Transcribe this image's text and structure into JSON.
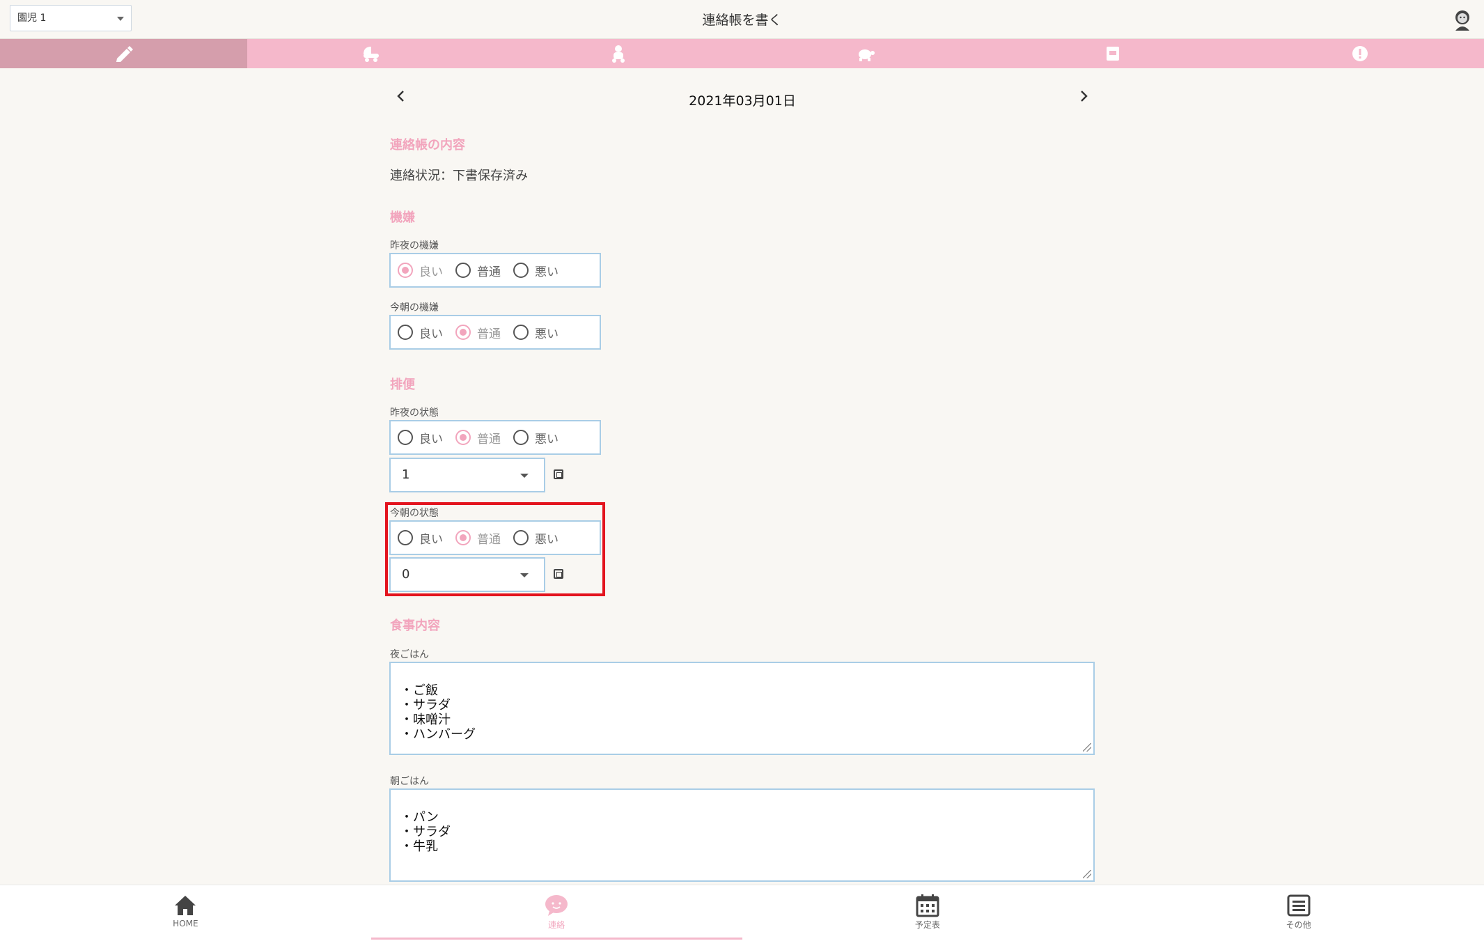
{
  "header": {
    "child_select": "園児 1",
    "title": "連絡帳を書く"
  },
  "tabs": [
    {
      "icon": "pencil-icon",
      "active": true
    },
    {
      "icon": "stroller-icon",
      "active": false
    },
    {
      "icon": "toddler-icon",
      "active": false
    },
    {
      "icon": "turtle-icon",
      "active": false
    },
    {
      "icon": "calendar-card-icon",
      "active": false
    },
    {
      "icon": "alert-icon",
      "active": false
    }
  ],
  "date_nav": {
    "date": "2021年03月01日"
  },
  "sections": {
    "content_title": "連絡帳の内容",
    "status": "連絡状況：下書保存済み",
    "mood_title": "機嫌",
    "bowel_title": "排便",
    "meal_title": "食事内容"
  },
  "mood": {
    "last_night": {
      "label": "昨夜の機嫌",
      "options": [
        "良い",
        "普通",
        "悪い"
      ],
      "selected": "良い"
    },
    "this_morning": {
      "label": "今朝の機嫌",
      "options": [
        "良い",
        "普通",
        "悪い"
      ],
      "selected": "普通"
    }
  },
  "bowel": {
    "last_night": {
      "label": "昨夜の状態",
      "options": [
        "良い",
        "普通",
        "悪い"
      ],
      "selected": "普通",
      "count": "1"
    },
    "this_morning": {
      "label": "今朝の状態",
      "options": [
        "良い",
        "普通",
        "悪い"
      ],
      "selected": "普通",
      "count": "0"
    }
  },
  "meals": {
    "dinner": {
      "label": "夜ごはん",
      "text": "・ご飯\n・サラダ\n・味噌汁\n・ハンバーグ"
    },
    "breakfast": {
      "label": "朝ごはん",
      "text": "・パン\n・サラダ\n・牛乳"
    }
  },
  "bottom_nav": [
    {
      "label": "HOME",
      "icon": "home-icon",
      "active": false
    },
    {
      "label": "連絡",
      "icon": "chat-face-icon",
      "active": true
    },
    {
      "label": "予定表",
      "icon": "calendar-icon",
      "active": false
    },
    {
      "label": "その他",
      "icon": "menu-icon",
      "active": false
    }
  ],
  "colors": {
    "accent_pink": "#f5b8cb",
    "active_tab": "#d59eac",
    "highlight_red": "#e3141e",
    "border_blue": "#a9cde6"
  }
}
